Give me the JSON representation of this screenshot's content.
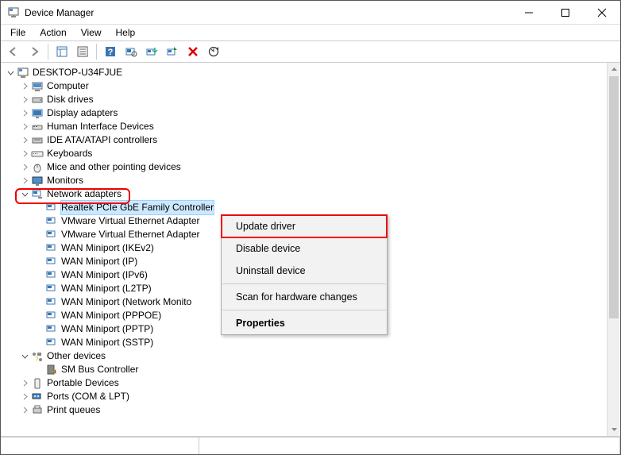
{
  "window": {
    "title": "Device Manager"
  },
  "menubar": {
    "file": "File",
    "action": "Action",
    "view": "View",
    "help": "Help"
  },
  "toolbar": {
    "back": "back-icon",
    "forward": "forward-icon",
    "show_hidden": "show-hidden-icon",
    "properties": "properties-icon",
    "help": "help-icon",
    "refresh": "refresh-icon",
    "update": "update-driver-icon",
    "enable": "enable-icon",
    "uninstall": "uninstall-icon",
    "scan": "scan-icon"
  },
  "tree": {
    "root": "DESKTOP-U34FJUE",
    "cat": {
      "computer": "Computer",
      "disk": "Disk drives",
      "display": "Display adapters",
      "hid": "Human Interface Devices",
      "ide": "IDE ATA/ATAPI controllers",
      "keyboards": "Keyboards",
      "mice": "Mice and other pointing devices",
      "monitors": "Monitors",
      "network": "Network adapters",
      "otherdev": "Other devices",
      "portable": "Portable Devices",
      "ports": "Ports (COM & LPT)",
      "printq": "Print queues"
    },
    "net": {
      "0": "Realtek PCIe GbE Family Controller",
      "1": "VMware Virtual Ethernet Adapter",
      "2": "VMware Virtual Ethernet Adapter",
      "3": "WAN Miniport (IKEv2)",
      "4": "WAN Miniport (IP)",
      "5": "WAN Miniport (IPv6)",
      "6": "WAN Miniport (L2TP)",
      "7": "WAN Miniport (Network Monito",
      "8": "WAN Miniport (PPPOE)",
      "9": "WAN Miniport (PPTP)",
      "10": "WAN Miniport (SSTP)"
    },
    "other": {
      "sm": "SM Bus Controller"
    }
  },
  "contextmenu": {
    "update": "Update driver",
    "disable": "Disable device",
    "uninstall": "Uninstall device",
    "scan": "Scan for hardware changes",
    "properties": "Properties"
  },
  "colors": {
    "highlight_red": "#e00000",
    "selection": "#cce8ff"
  }
}
